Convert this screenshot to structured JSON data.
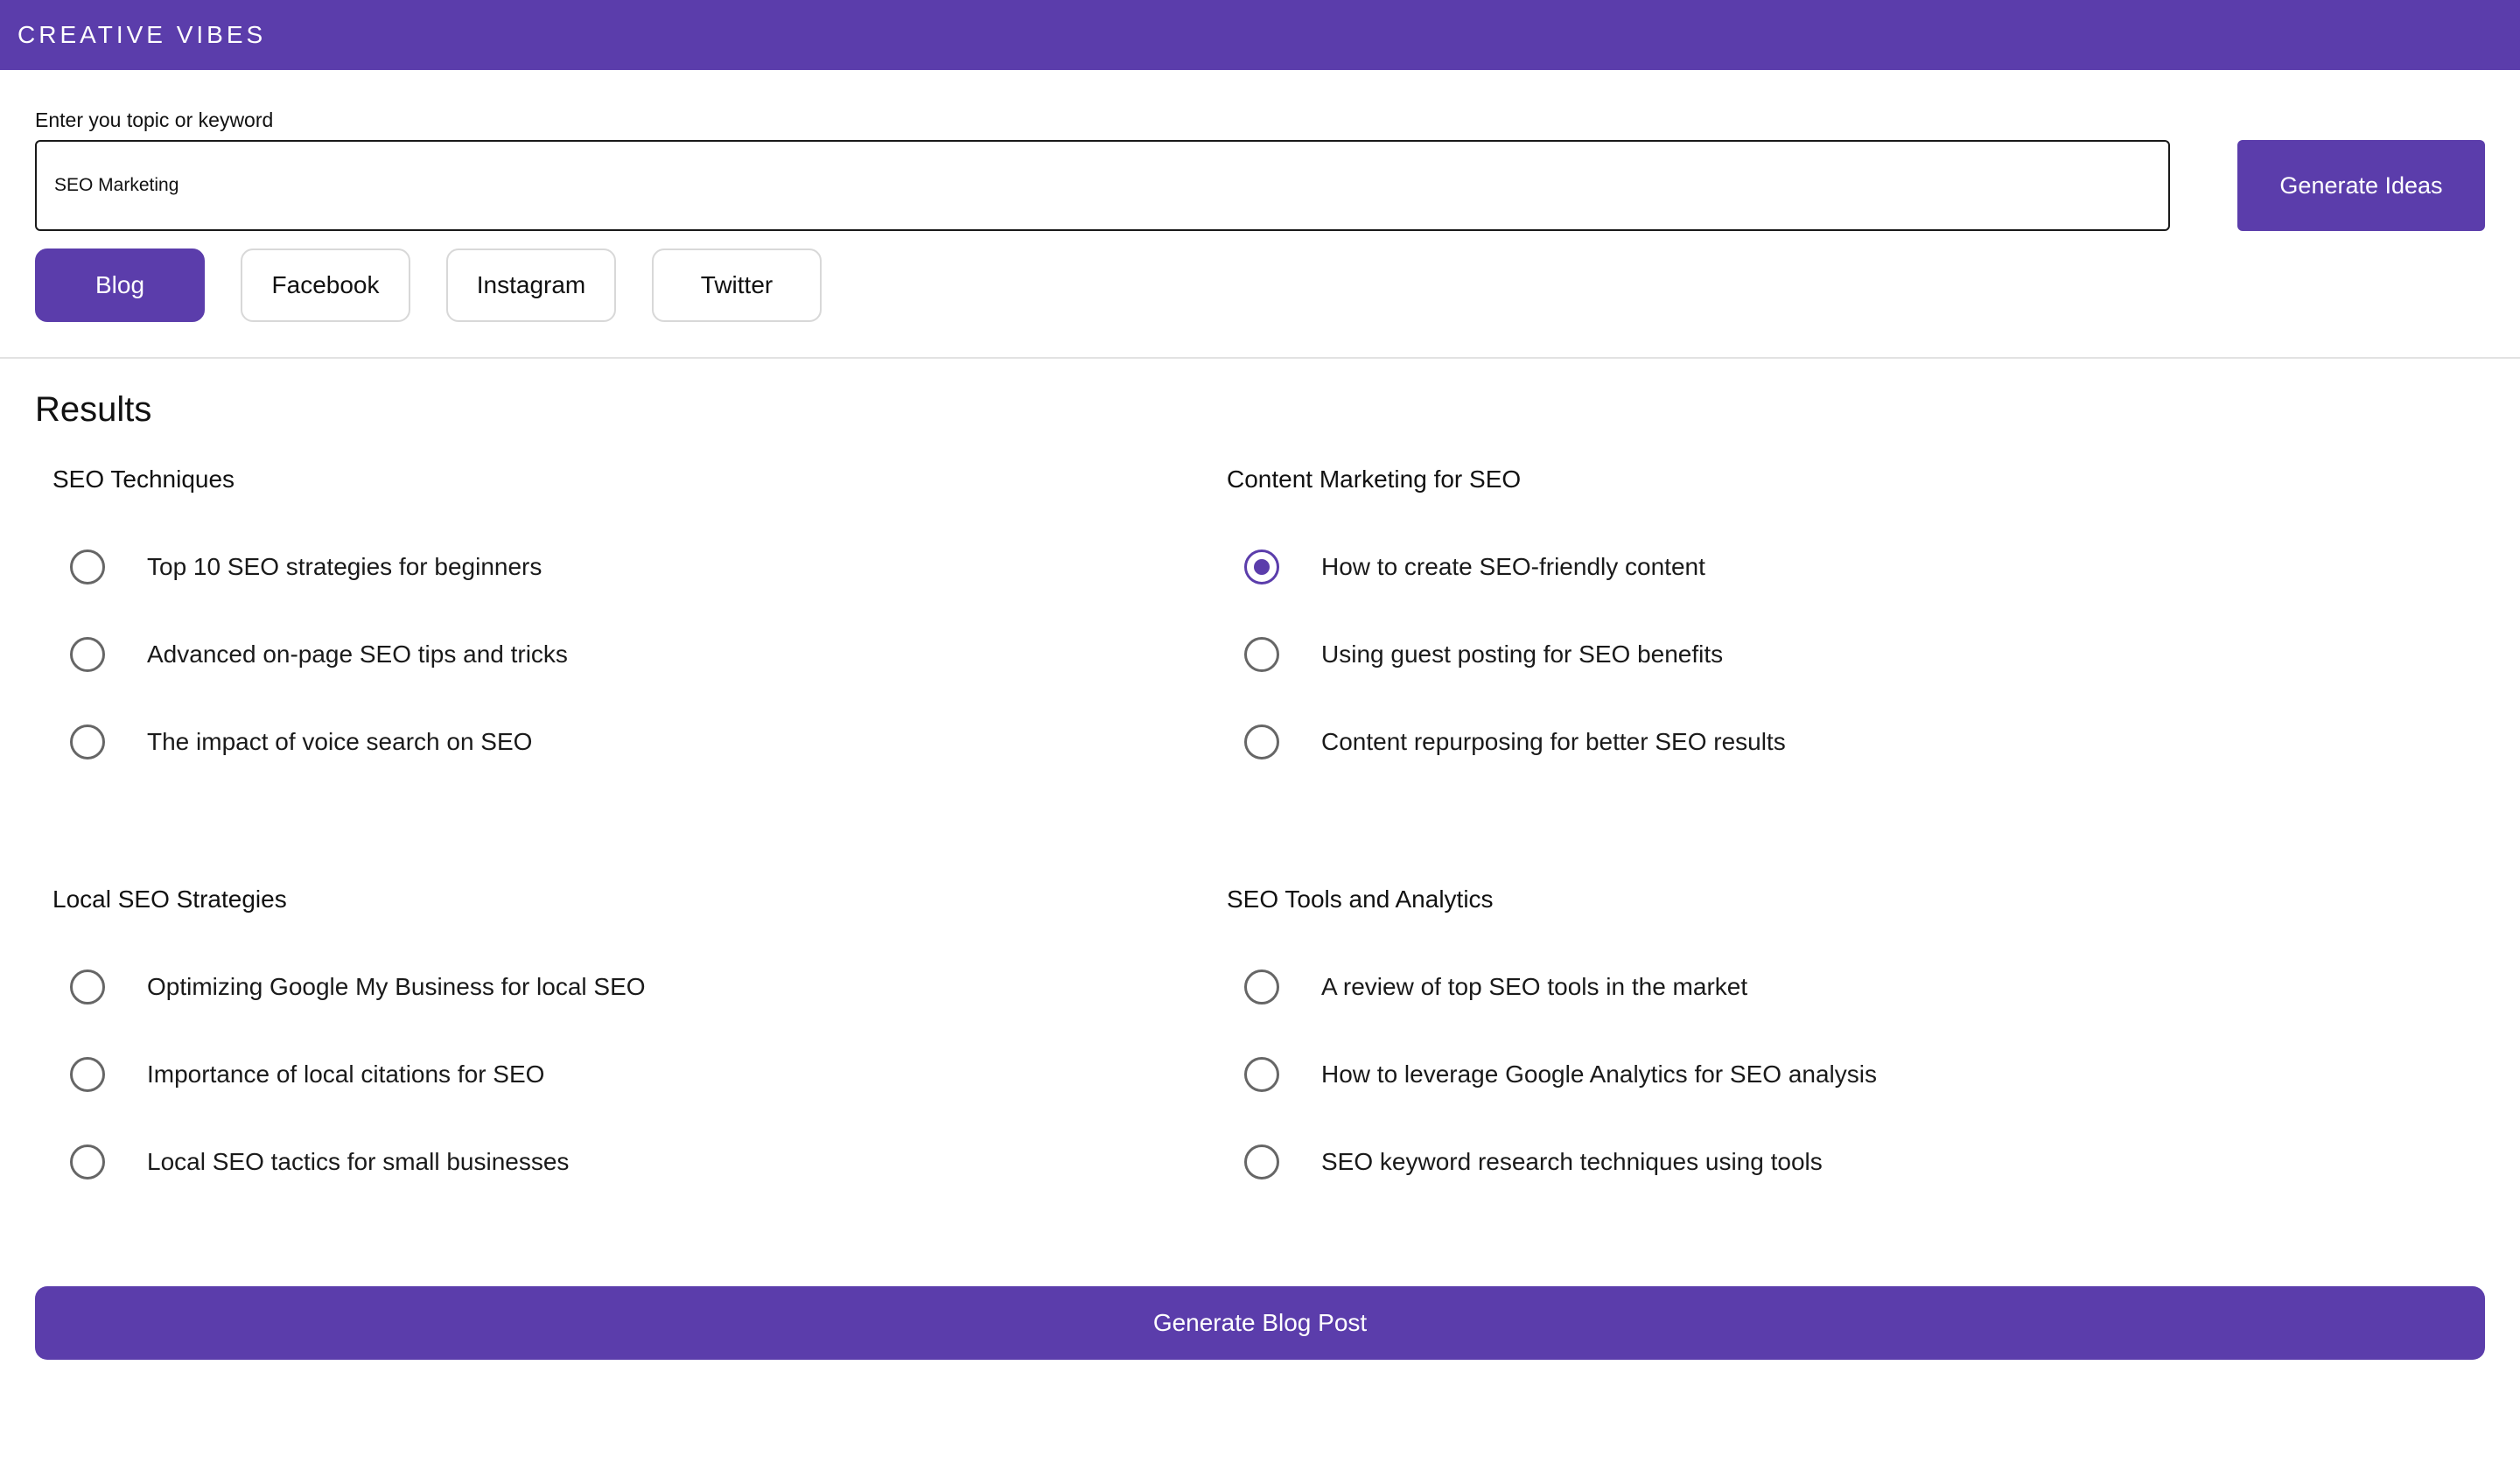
{
  "header": {
    "brand": "CREATIVE VIBES"
  },
  "search": {
    "label": "Enter you topic or keyword",
    "value": "SEO Marketing",
    "generate_label": "Generate Ideas"
  },
  "platform_tabs": [
    {
      "label": "Blog",
      "active": true
    },
    {
      "label": "Facebook",
      "active": false
    },
    {
      "label": "Instagram",
      "active": false
    },
    {
      "label": "Twitter",
      "active": false
    }
  ],
  "results": {
    "title": "Results",
    "groups": [
      {
        "title": "SEO Techniques",
        "options": [
          {
            "label": "Top 10 SEO strategies for beginners",
            "checked": false
          },
          {
            "label": "Advanced on-page SEO tips and tricks",
            "checked": false
          },
          {
            "label": "The impact of voice search on SEO",
            "checked": false
          }
        ]
      },
      {
        "title": "Content Marketing for SEO",
        "options": [
          {
            "label": "How to create SEO-friendly content",
            "checked": true
          },
          {
            "label": "Using guest posting for SEO benefits",
            "checked": false
          },
          {
            "label": "Content repurposing for better SEO results",
            "checked": false
          }
        ]
      },
      {
        "title": "Local SEO Strategies",
        "options": [
          {
            "label": "Optimizing Google My Business for local SEO",
            "checked": false
          },
          {
            "label": "Importance of local citations for SEO",
            "checked": false
          },
          {
            "label": "Local SEO tactics for small businesses",
            "checked": false
          }
        ]
      },
      {
        "title": "SEO Tools and Analytics",
        "options": [
          {
            "label": "A review of top SEO tools in the market",
            "checked": false
          },
          {
            "label": "How to leverage Google Analytics for SEO analysis",
            "checked": false
          },
          {
            "label": "SEO keyword research techniques using tools",
            "checked": false
          }
        ]
      }
    ]
  },
  "footer": {
    "generate_post_label": "Generate Blog Post"
  },
  "colors": {
    "accent": "#5b3dab"
  }
}
